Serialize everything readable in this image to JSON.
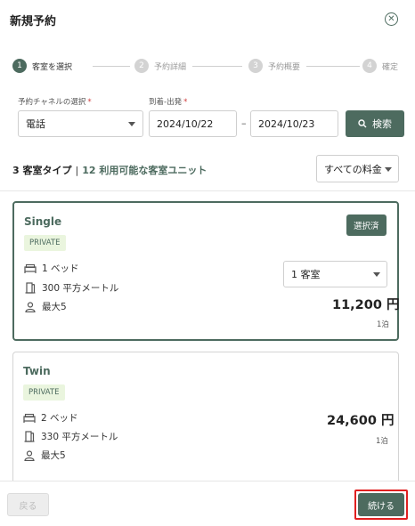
{
  "dialog": {
    "title": "新規予約"
  },
  "steps": [
    {
      "num": "1",
      "label": "客室を選択"
    },
    {
      "num": "2",
      "label": "予約詳細"
    },
    {
      "num": "3",
      "label": "予約概要"
    },
    {
      "num": "4",
      "label": "確定"
    }
  ],
  "form": {
    "channel_label": "予約チャネルの選択",
    "channel_value": "電話",
    "dates_label": "到着-出発",
    "required_mark": "*",
    "checkin": "2024/10/22",
    "dash": "–",
    "checkout": "2024/10/23",
    "search_label": "検索"
  },
  "summary": {
    "room_types": "3 客室タイプ",
    "separator": "|",
    "units": "12 利用可能な客室ユニット",
    "rate_filter": "すべての料金"
  },
  "rooms": [
    {
      "name": "Single",
      "badge": "PRIVATE",
      "beds": "1 ベッド",
      "area": "300 平方メートル",
      "capacity": "最大5",
      "selected_label": "選択済",
      "quantity": "1 客室",
      "price": "11,200 円",
      "per": "1泊"
    },
    {
      "name": "Twin",
      "badge": "PRIVATE",
      "beds": "2 ベッド",
      "area": "330 平方メートル",
      "capacity": "最大5",
      "price": "24,600 円",
      "per": "1泊"
    }
  ],
  "footer": {
    "back_label": "戻る",
    "continue_label": "続ける"
  },
  "colors": {
    "accent": "#4d6b5f",
    "highlight": "#e02020",
    "badge_bg": "#eaf5de"
  },
  "icons": [
    "close-icon",
    "search-icon",
    "bed-icon",
    "door-icon",
    "person-icon",
    "chevron-down-icon"
  ]
}
